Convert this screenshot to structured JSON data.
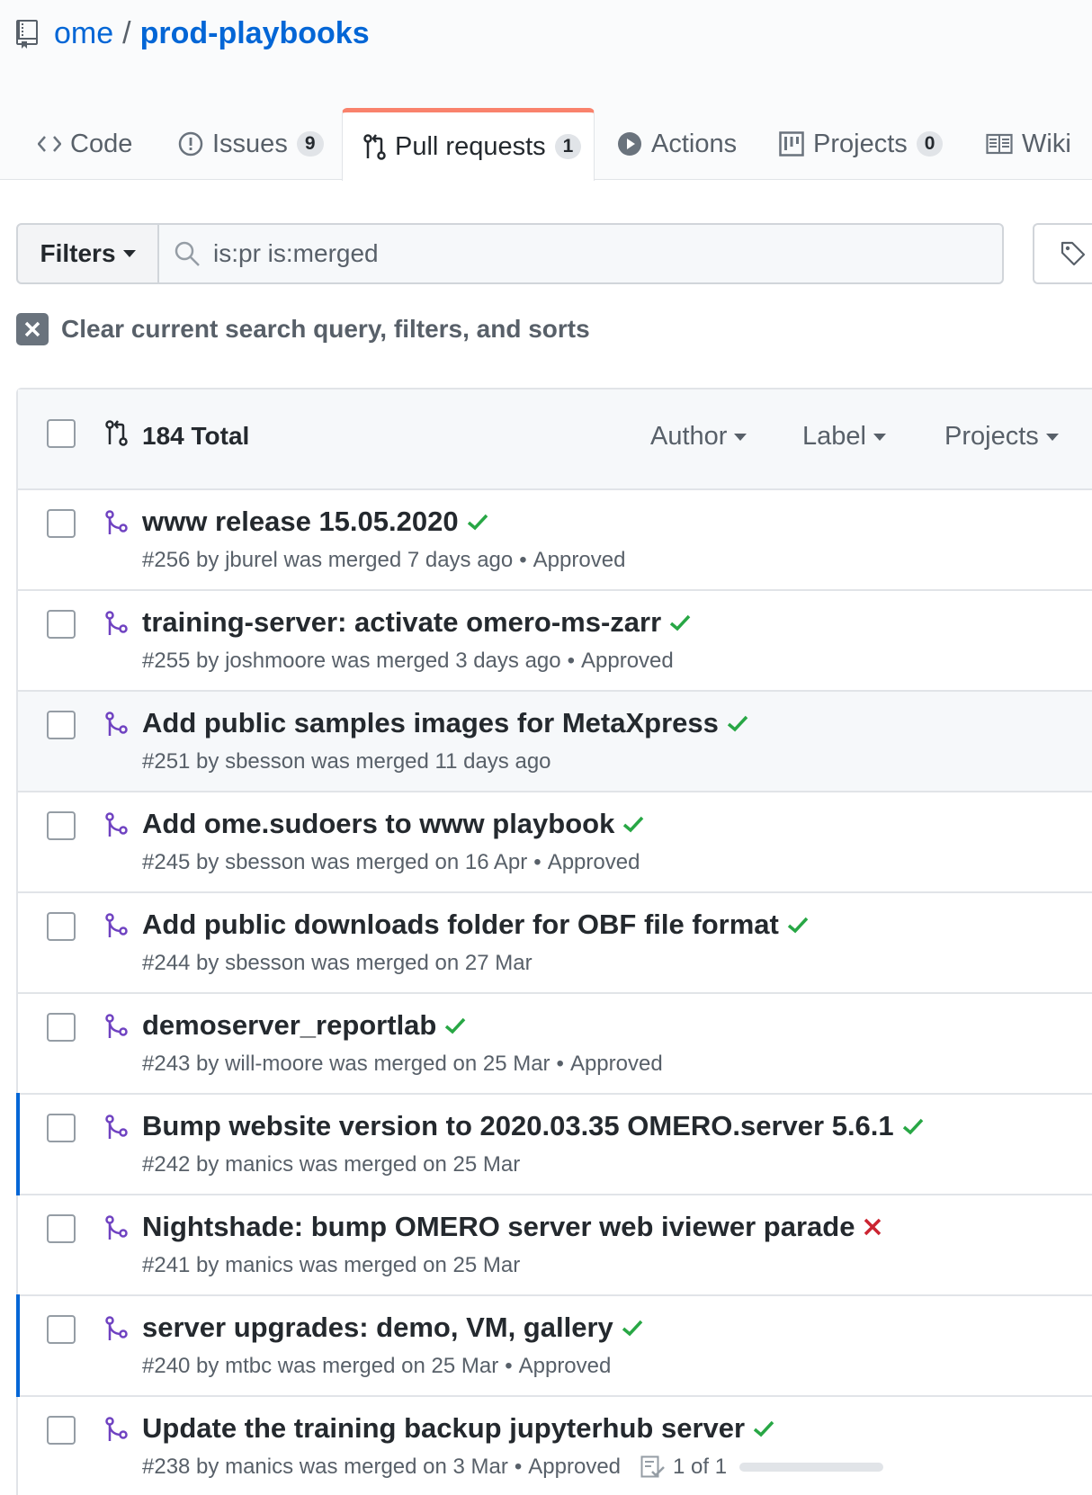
{
  "repo": {
    "owner": "ome",
    "separator": "/",
    "name": "prod-playbooks"
  },
  "tabs": [
    {
      "label": "Code",
      "icon": "code-icon"
    },
    {
      "label": "Issues",
      "icon": "issue-icon",
      "count": "9"
    },
    {
      "label": "Pull requests",
      "icon": "pull-request-icon",
      "count": "1",
      "selected": true
    },
    {
      "label": "Actions",
      "icon": "play-icon"
    },
    {
      "label": "Projects",
      "icon": "project-icon",
      "count": "0"
    },
    {
      "label": "Wiki",
      "icon": "book-icon"
    }
  ],
  "filters": {
    "label": "Filters",
    "search_value": "is:pr is:merged"
  },
  "clear": {
    "label": "Clear current search query, filters, and sorts"
  },
  "list_header": {
    "total": "184 Total",
    "author": "Author",
    "label": "Label",
    "projects": "Projects"
  },
  "colors": {
    "accent": "#0366d6",
    "merged": "#6f42c1",
    "success": "#28a745",
    "failure": "#cb2431",
    "tab_highlight": "#f9826c"
  },
  "pull_requests": [
    {
      "title": "www release 15.05.2020",
      "status": "success",
      "meta": "#256 by jburel was merged 7 days ago",
      "review": "Approved"
    },
    {
      "title": "training-server: activate omero-ms-zarr",
      "status": "success",
      "meta": "#255 by joshmoore was merged 3 days ago",
      "review": "Approved"
    },
    {
      "title": "Add public samples images for MetaXpress",
      "status": "success",
      "meta": "#251 by sbesson was merged 11 days ago",
      "review": ""
    },
    {
      "title": "Add ome.sudoers to www playbook",
      "status": "success",
      "meta": "#245 by sbesson was merged on 16 Apr",
      "review": "Approved"
    },
    {
      "title": "Add public downloads folder for OBF file format",
      "status": "success",
      "meta": "#244 by sbesson was merged on 27 Mar",
      "review": ""
    },
    {
      "title": "demoserver_reportlab",
      "status": "success",
      "meta": "#243 by will-moore was merged on 25 Mar",
      "review": "Approved"
    },
    {
      "title": "Bump website version to 2020.03.35 OMERO.server 5.6.1",
      "status": "success",
      "meta": "#242 by manics was merged on 25 Mar",
      "review": ""
    },
    {
      "title": "Nightshade: bump OMERO server web iviewer parade",
      "status": "failure",
      "meta": "#241 by manics was merged on 25 Mar",
      "review": ""
    },
    {
      "title": "server upgrades: demo, VM, gallery",
      "status": "success",
      "meta": "#240 by mtbc was merged on 25 Mar",
      "review": "Approved"
    },
    {
      "title": "Update the training backup jupyterhub server",
      "status": "success",
      "meta": "#238 by manics was merged on 3 Mar",
      "review": "Approved",
      "tasks": "1 of 1",
      "tasks_progress": 1.0
    }
  ]
}
